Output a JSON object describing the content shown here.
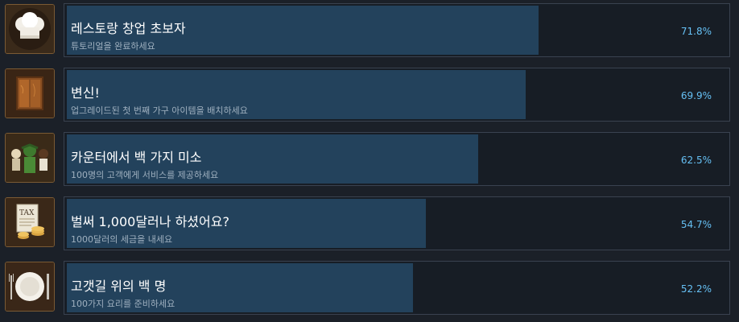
{
  "achievements": [
    {
      "title": "레스토랑 창업 초보자",
      "description": "튜토리얼을 완료하세요",
      "percent_label": "71.8%",
      "percent": 71.8,
      "icon": "chef-hat-icon"
    },
    {
      "title": "변신!",
      "description": "업그레이드된 첫 번째 가구 아이템을 배치하세요",
      "percent_label": "69.9%",
      "percent": 69.9,
      "icon": "wooden-cabinet-icon"
    },
    {
      "title": "카운터에서 백 가지 미소",
      "description": "100명의 고객에게 서비스를 제공하세요",
      "percent_label": "62.5%",
      "percent": 62.5,
      "icon": "customers-icon"
    },
    {
      "title": "벌써 1,000달러나 하셨어요?",
      "description": "1000달러의 세금을 내세요",
      "percent_label": "54.7%",
      "percent": 54.7,
      "icon": "tax-coins-icon",
      "icon_text": "TAX"
    },
    {
      "title": "고갯길 위의 백 명",
      "description": "100가지 요리를 준비하세요",
      "percent_label": "52.2%",
      "percent": 52.2,
      "icon": "plate-cutlery-icon"
    }
  ]
}
